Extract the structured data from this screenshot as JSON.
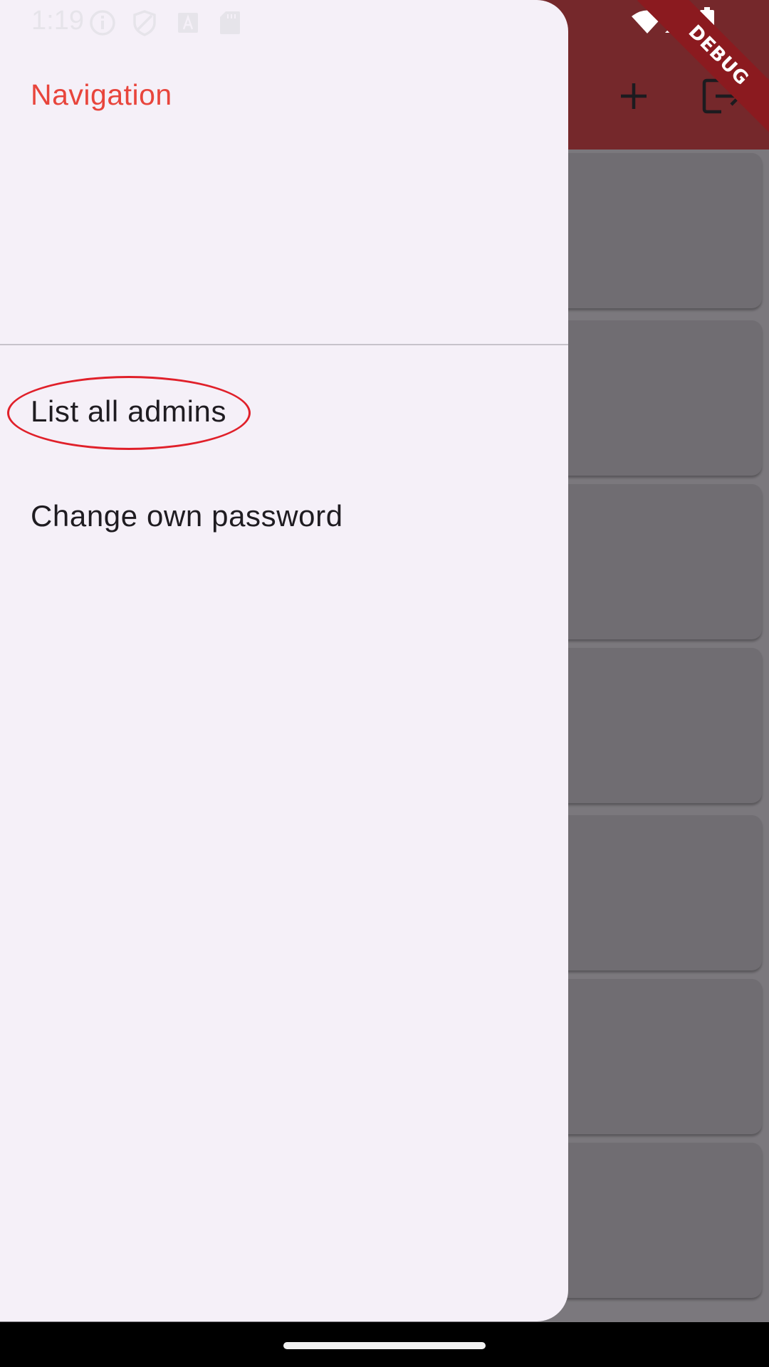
{
  "status_bar": {
    "time": "1:19",
    "icons": [
      "info-icon",
      "shield-icon",
      "text-a-icon",
      "sd-card-icon",
      "wifi-icon",
      "signal-icon",
      "battery-icon"
    ]
  },
  "debug_banner": {
    "label": "DEBUG"
  },
  "app_bar": {
    "actions": [
      "add-icon",
      "logout-icon"
    ],
    "color": "#75282b"
  },
  "drawer": {
    "header_title": "Navigation",
    "items": [
      {
        "label": "List all admins",
        "highlighted": true
      },
      {
        "label": "Change own password",
        "highlighted": false
      }
    ],
    "accent_color": "#e8453c",
    "background": "#f5f0f8"
  },
  "background_list": {
    "card_count": 7
  },
  "colors": {
    "highlight_ring": "#e0202a",
    "scrim_card": "#706d72"
  }
}
